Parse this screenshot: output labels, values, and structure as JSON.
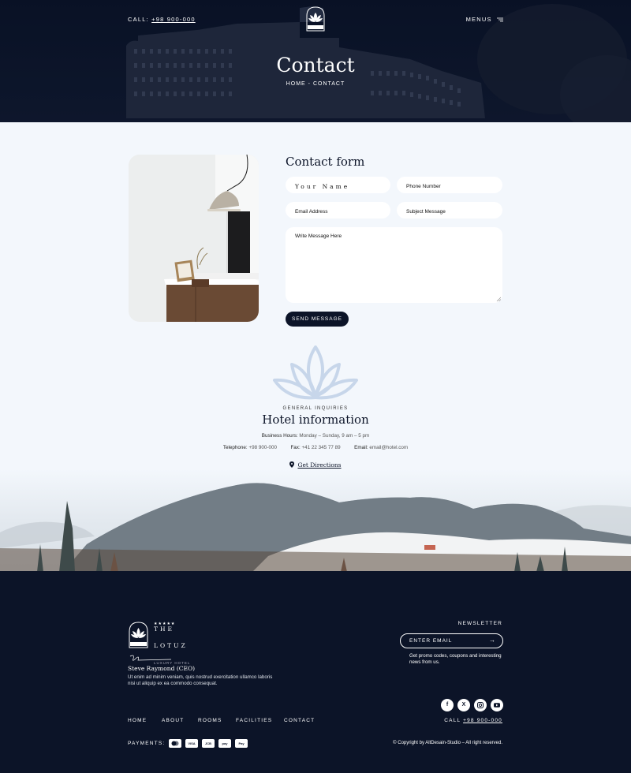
{
  "header": {
    "call_label": "CALL:",
    "call_number": "+98 900-000",
    "menus_label": "MENUS",
    "page_title": "Contact",
    "breadcrumb": "HOME - CONTACT"
  },
  "contact_form": {
    "title": "Contact form",
    "name_placeholder": "Your Name",
    "phone_placeholder": "Phone Number",
    "email_placeholder": "Email Address",
    "subject_placeholder": "Subject Message",
    "message_placeholder": "Write Message Here",
    "send_label": "SEND MESSAGE"
  },
  "info": {
    "eyebrow": "GENERAL INQUIRIES",
    "title": "Hotel information",
    "hours_label": "Business Hours:",
    "hours_value": "Monday – Sunday, 9 am – 5 pm",
    "telephone_label": "Telephone:",
    "telephone_value": "+98 900-000",
    "fax_label": "Fax:",
    "fax_value": "+41 22 345 77 89",
    "email_label": "Email:",
    "email_value": "email@hotel.com",
    "directions_label": "Get Directions"
  },
  "footer": {
    "stars": "★★★★★",
    "brand_line1": "THE",
    "brand_line2": "LOTUZ",
    "brand_sub": "LUXURY HOTEL",
    "ceo_name": "Steve Raymond (CEO)",
    "ceo_text": "Ut enim ad minim veniam, quis nostrud exercitation ullamco laboris nisi ut aliquip ex ea commodo consequat.",
    "newsletter_title": "NEWSLETTER",
    "newsletter_placeholder": "ENTER EMAIL",
    "newsletter_note": "Get promo codes, coupons and interesting news from us.",
    "nav": [
      "HOME",
      "ABOUT",
      "ROOMS",
      "FACILITIES",
      "CONTACT"
    ],
    "call_label": "CALL",
    "call_number": "+98 900-000",
    "payments_label": "PAYMENTS:",
    "payment_icons": [
      "mastercard-icon",
      "visa-icon",
      "jcb-icon",
      "amazon-pay-icon",
      "apple-pay-icon"
    ],
    "payment_texts": [
      "VISA",
      "JCB",
      "pay",
      "Pay"
    ],
    "copyright": "© Copyright by AltDesain-Studio – All right reserved."
  },
  "colors": {
    "navy": "#0c1428",
    "background": "#f3f7fc",
    "lotus_watermark": "#c7d6ea"
  }
}
